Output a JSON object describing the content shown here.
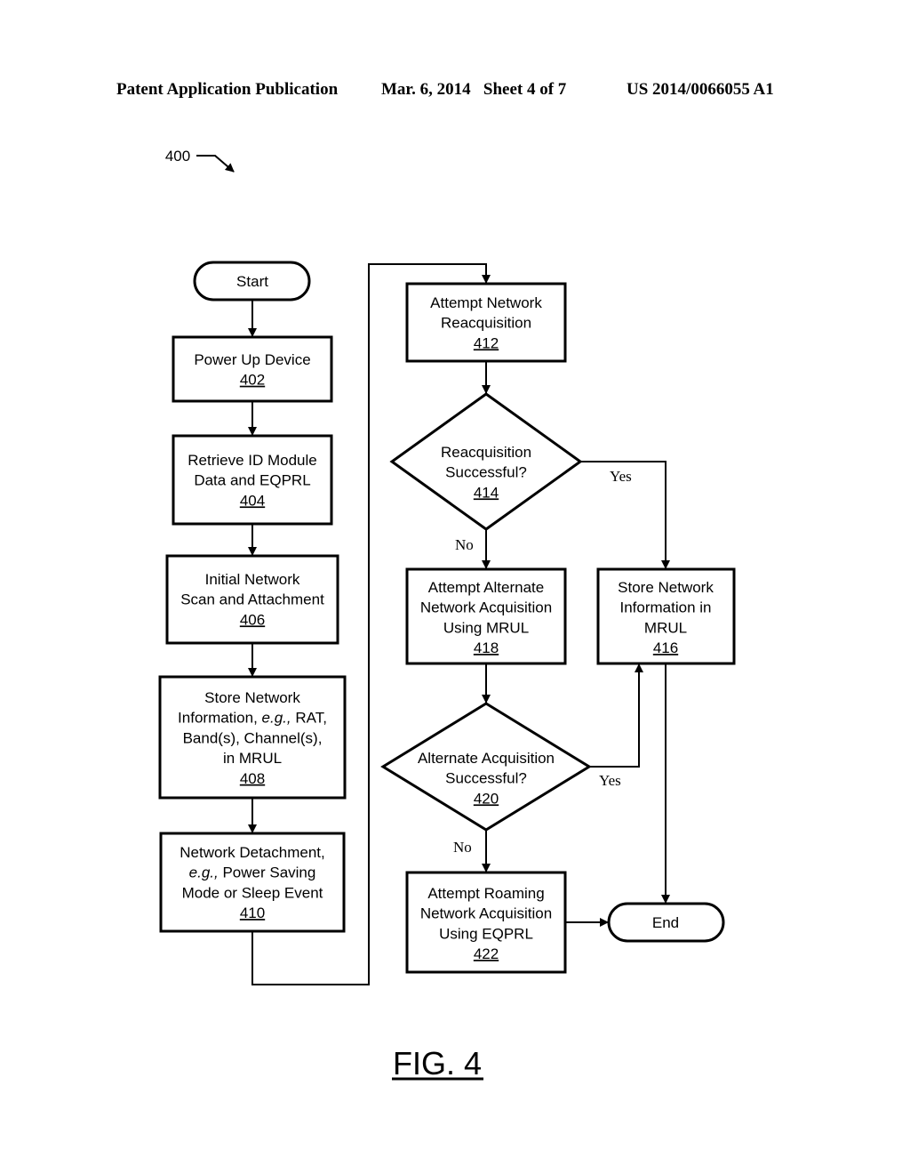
{
  "header": {
    "publication": "Patent Application Publication",
    "date_sheet": "Mar. 6, 2014   Sheet 4 of 7",
    "patent_number": "US 2014/0066055 A1"
  },
  "figure_ref": "400",
  "figure_caption": "FIG. 4",
  "nodes": {
    "start": {
      "lines": [
        "Start"
      ],
      "ref": ""
    },
    "n402": {
      "lines": [
        "Power Up Device"
      ],
      "ref": "402"
    },
    "n404": {
      "lines": [
        "Retrieve ID Module",
        "Data and EQPRL"
      ],
      "ref": "404"
    },
    "n406": {
      "lines": [
        "Initial Network",
        "Scan and Attachment"
      ],
      "ref": "406"
    },
    "n408": {
      "lines": [
        "Store Network",
        "Information, e.g., RAT,",
        "Band(s), Channel(s),",
        "in MRUL"
      ],
      "ref": "408"
    },
    "n410": {
      "lines": [
        "Network Detachment,",
        "e.g., Power Saving",
        "Mode or Sleep Event"
      ],
      "ref": "410"
    },
    "n412": {
      "lines": [
        "Attempt Network",
        "Reacquisition"
      ],
      "ref": "412"
    },
    "n414": {
      "lines": [
        "Reacquisition",
        "Successful?"
      ],
      "ref": "414"
    },
    "n416": {
      "lines": [
        "Store Network",
        "Information in",
        "MRUL"
      ],
      "ref": "416"
    },
    "n418": {
      "lines": [
        "Attempt Alternate",
        "Network Acquisition",
        "Using MRUL"
      ],
      "ref": "418"
    },
    "n420": {
      "lines": [
        "Alternate Acquisition",
        "Successful?"
      ],
      "ref": "420"
    },
    "n422": {
      "lines": [
        "Attempt Roaming",
        "Network Acquisition",
        "Using EQPRL"
      ],
      "ref": "422"
    },
    "end": {
      "lines": [
        "End"
      ],
      "ref": ""
    }
  },
  "edge_labels": {
    "yes_414": "Yes",
    "no_414": "No",
    "yes_420": "Yes",
    "no_420": "No"
  }
}
